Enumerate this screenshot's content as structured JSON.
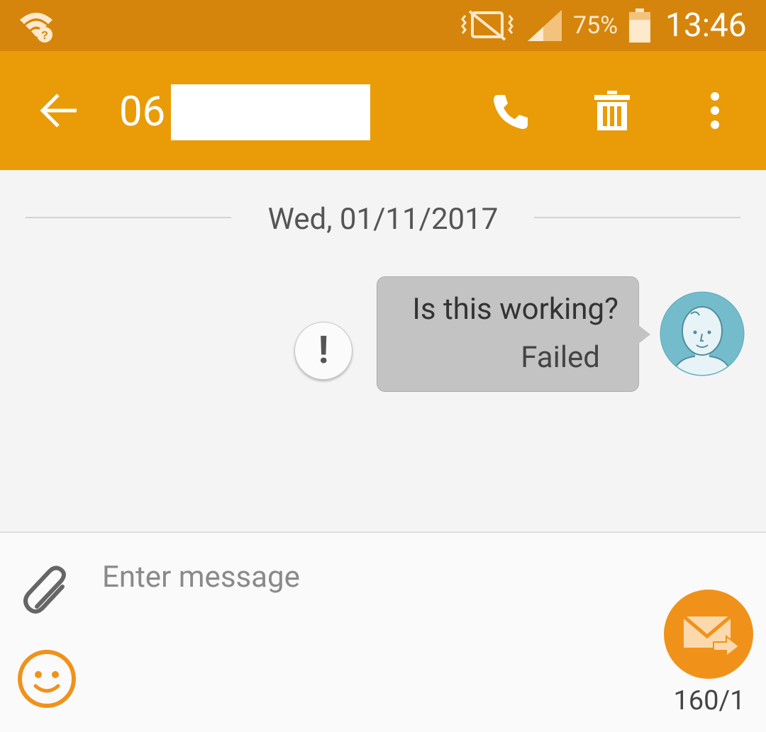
{
  "status_bar": {
    "battery_percent": "75%",
    "time": "13:46",
    "icons": [
      "wifi-question-icon",
      "vibrate-off-icon",
      "signal-icon",
      "battery-icon"
    ],
    "color": "#d6850c"
  },
  "app_bar": {
    "title": "06",
    "color": "#e99c07",
    "icons": [
      "back-arrow-icon",
      "phone-icon",
      "trash-icon",
      "more-vert-icon"
    ]
  },
  "conversation": {
    "date": "Wed, 01/11/2017",
    "messages": [
      {
        "text": "Is this working?",
        "status": "Failed",
        "direction": "outgoing"
      }
    ]
  },
  "composer": {
    "placeholder": "Enter message",
    "value": "",
    "counter": "160/1",
    "send_color": "#f0921a",
    "icons": [
      "attach-icon",
      "emoji-icon",
      "send-icon"
    ]
  }
}
